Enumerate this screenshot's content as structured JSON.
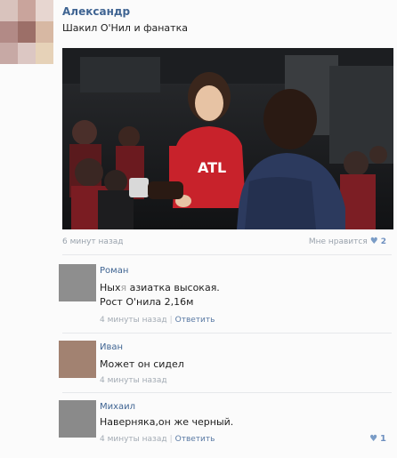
{
  "post": {
    "author": "Александр",
    "text": "Шакил О'Нил и фанатка",
    "time": "6 минут назад",
    "like_label": "Мне нравится",
    "like_icon": "heart-icon",
    "like_count": "2",
    "photo_jersey_text": "ATL"
  },
  "comments": [
    {
      "name": "Роман",
      "text_line1_pre": "Ных",
      "text_line1_censor": "я",
      "text_line1_post": " азиатка высокая.",
      "text_line2": "Рост О'нила 2,16м",
      "time": "4 минуты назад",
      "reply": "Ответить",
      "avatar_color": "#8e8e8e"
    },
    {
      "name": "Иван",
      "text": "Может он сидел",
      "time": "4 минуты назад",
      "avatar_color": "#a28271"
    },
    {
      "name": "Михаил",
      "text": "Наверняка,он же черный.",
      "time": "4 минуты назад",
      "reply": "Ответить",
      "like_icon": "heart-icon",
      "like_count": "1",
      "avatar_color": "#8a8a8a"
    }
  ],
  "colors": {
    "link": "#3f6492",
    "meta": "#9aa3ad",
    "heart": "#7a9cc6"
  }
}
